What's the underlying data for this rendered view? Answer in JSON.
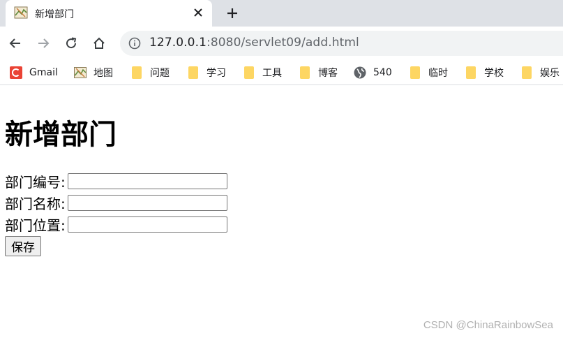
{
  "browser": {
    "tab": {
      "title": "新增部门",
      "favicon": "map-favicon-icon",
      "close_icon": "close-icon"
    },
    "new_tab_icon": "plus-icon",
    "nav": {
      "back": "back-arrow-icon",
      "forward": "forward-arrow-icon",
      "reload": "reload-icon",
      "home": "home-icon"
    },
    "omnibox": {
      "info_icon": "info-icon",
      "host": "127.0.0.1",
      "port": ":8080",
      "path": "/servlet09/add.html"
    },
    "bookmarks": [
      {
        "label": "Gmail",
        "icon": "gmail-icon"
      },
      {
        "label": "地图",
        "icon": "map-icon"
      },
      {
        "label": "问题",
        "icon": "folder-icon"
      },
      {
        "label": "学习",
        "icon": "folder-icon"
      },
      {
        "label": "工具",
        "icon": "folder-icon"
      },
      {
        "label": "博客",
        "icon": "folder-icon"
      },
      {
        "label": "540",
        "icon": "globe-icon"
      },
      {
        "label": "临时",
        "icon": "folder-icon"
      },
      {
        "label": "学校",
        "icon": "folder-icon"
      },
      {
        "label": "娱乐",
        "icon": "folder-icon"
      }
    ]
  },
  "page": {
    "title": "新增部门",
    "fields": [
      {
        "label": "部门编号:",
        "value": ""
      },
      {
        "label": "部门名称:",
        "value": ""
      },
      {
        "label": "部门位置:",
        "value": ""
      }
    ],
    "save_label": "保存"
  },
  "watermark": "CSDN @ChinaRainbowSea",
  "colors": {
    "tabstrip": "#dee1e6",
    "omnibox": "#f1f3f4",
    "folder": "#fdd663",
    "gmail": "#ea4335"
  }
}
